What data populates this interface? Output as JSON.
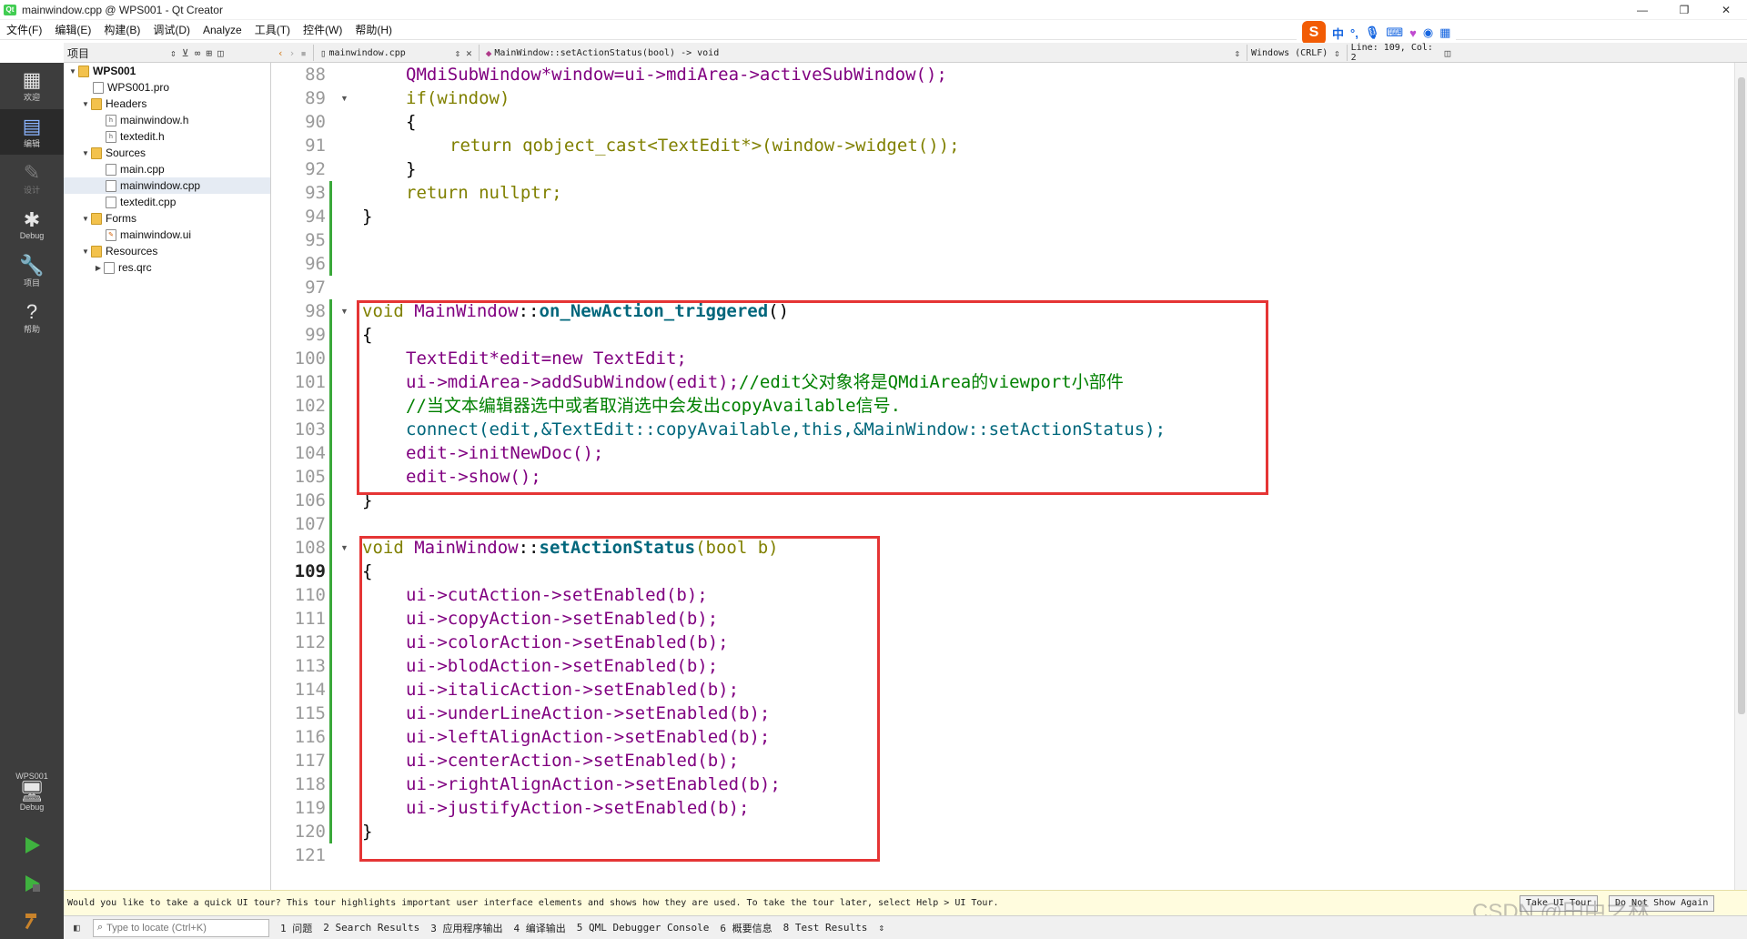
{
  "window": {
    "title": "mainwindow.cpp @ WPS001 - Qt Creator",
    "app_icon_text": "Qt",
    "controls": [
      "—",
      "❐",
      "✕"
    ]
  },
  "menu": [
    "文件(F)",
    "编辑(E)",
    "构建(B)",
    "调试(D)",
    "Analyze",
    "工具(T)",
    "控件(W)",
    "帮助(H)"
  ],
  "ime": {
    "logo": "S",
    "mode": "中",
    "punct": "°,"
  },
  "toolbar": {
    "project_label": "项目",
    "file_tab": "mainwindow.cpp",
    "symbol": "MainWindow::setActionStatus(bool) -> void",
    "line_ending": "Windows (CRLF)",
    "position": "Line: 109, Col: 2"
  },
  "modes": [
    {
      "label": "欢迎"
    },
    {
      "label": "编辑"
    },
    {
      "label": "设计"
    },
    {
      "label": "Debug"
    },
    {
      "label": "项目"
    },
    {
      "label": "帮助"
    }
  ],
  "kit": {
    "project": "WPS001",
    "config": "Debug"
  },
  "tree": [
    {
      "label": "WPS001"
    },
    {
      "label": "WPS001.pro"
    },
    {
      "label": "Headers"
    },
    {
      "label": "mainwindow.h"
    },
    {
      "label": "textedit.h"
    },
    {
      "label": "Sources"
    },
    {
      "label": "main.cpp"
    },
    {
      "label": "mainwindow.cpp"
    },
    {
      "label": "textedit.cpp"
    },
    {
      "label": "Forms"
    },
    {
      "label": "mainwindow.ui"
    },
    {
      "label": "Resources"
    },
    {
      "label": "res.qrc"
    }
  ],
  "editor": {
    "line_numbers": [
      "88",
      "89",
      "90",
      "91",
      "92",
      "93",
      "94",
      "95",
      "96",
      "97",
      "98",
      "99",
      "100",
      "101",
      "102",
      "103",
      "104",
      "105",
      "106",
      "107",
      "108",
      "109",
      "110",
      "111",
      "112",
      "113",
      "114",
      "115",
      "116",
      "117",
      "118",
      "119",
      "120",
      "121"
    ],
    "current_line": "109",
    "code": {
      "l88_var": "QMdiSubWindow*window=ui->mdiArea->activeSubWindow();",
      "l89": "if(window)",
      "l90": "{",
      "l91_ret": "return qobject_cast<TextEdit*>(window->widget());",
      "l92": "}",
      "l93": "return nullptr;",
      "l94": "}",
      "l98_void": "void",
      "l98_cls": "MainWindow",
      "l98_sep": "::",
      "l98_fn": "on_NewAction_triggered",
      "l98_tail": "()",
      "l99": "{",
      "l100": "TextEdit*edit=new TextEdit;",
      "l101_code": "ui->mdiArea->addSubWindow(edit);",
      "l101_comment": "//edit父对象将是QMdiArea的viewport小部件",
      "l102_comment": "//当文本编辑器选中或者取消选中会发出copyAvailable信号.",
      "l103": "connect(edit,&TextEdit::copyAvailable,this,&MainWindow::setActionStatus);",
      "l104": "edit->initNewDoc();",
      "l105": "edit->show();",
      "l106": "}",
      "l108_void": "void",
      "l108_cls": "MainWindow",
      "l108_sep": "::",
      "l108_fn": "setActionStatus",
      "l108_params": "(bool b)",
      "l109": "{",
      "l110": "ui->cutAction->setEnabled(b);",
      "l111": "ui->copyAction->setEnabled(b);",
      "l112": "ui->colorAction->setEnabled(b);",
      "l113": "ui->blodAction->setEnabled(b);",
      "l114": "ui->italicAction->setEnabled(b);",
      "l115": "ui->underLineAction->setEnabled(b);",
      "l116": "ui->leftAlignAction->setEnabled(b);",
      "l117": "ui->centerAction->setEnabled(b);",
      "l118": "ui->rightAlignAction->setEnabled(b);",
      "l119": "ui->justifyAction->setEnabled(b);",
      "l120": "}"
    }
  },
  "infobar": {
    "message": "Would you like to take a quick UI tour? This tour highlights important user interface elements and shows how they are used. To take the tour later, select Help > UI Tour.",
    "tour_button": "Take UI Tour",
    "dismiss_button": "Do Not Show Again"
  },
  "statusbar": {
    "locator_placeholder": "Type to locate (Ctrl+K)",
    "tabs": [
      "1 问题",
      "2 Search Results",
      "3 应用程序输出",
      "4 编译输出",
      "5 QML Debugger Console",
      "6 概要信息",
      "8 Test Results"
    ]
  },
  "watermark": "CSDN @田中之林",
  "colors": {
    "keyword": "#808000",
    "type": "#800080",
    "function": "#00677c",
    "comment": "#008000",
    "highlight_box": "#e53535",
    "modebar": "#3d3d3d"
  }
}
